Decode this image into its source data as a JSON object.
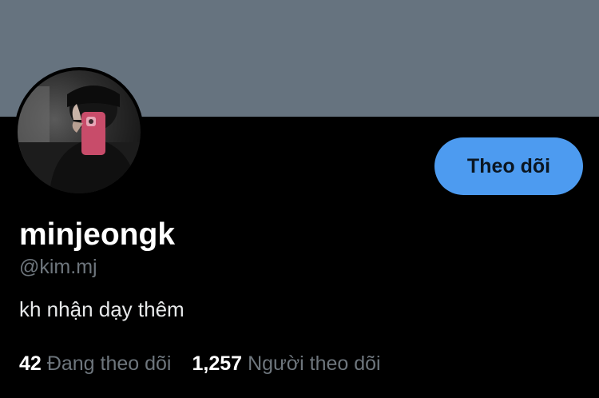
{
  "profile": {
    "display_name": "minjeongk",
    "handle": "@kim.mj",
    "bio": "kh nhận dạy thêm"
  },
  "actions": {
    "follow_label": "Theo dõi"
  },
  "stats": {
    "following_count": "42",
    "following_label": "Đang theo dõi",
    "followers_count": "1,257",
    "followers_label": "Người theo dõi"
  },
  "colors": {
    "banner": "#66737f",
    "background": "#000000",
    "follow_button": "#4d9bf0",
    "muted_text": "#6e767d"
  },
  "icons": {
    "avatar": "profile-photo"
  }
}
